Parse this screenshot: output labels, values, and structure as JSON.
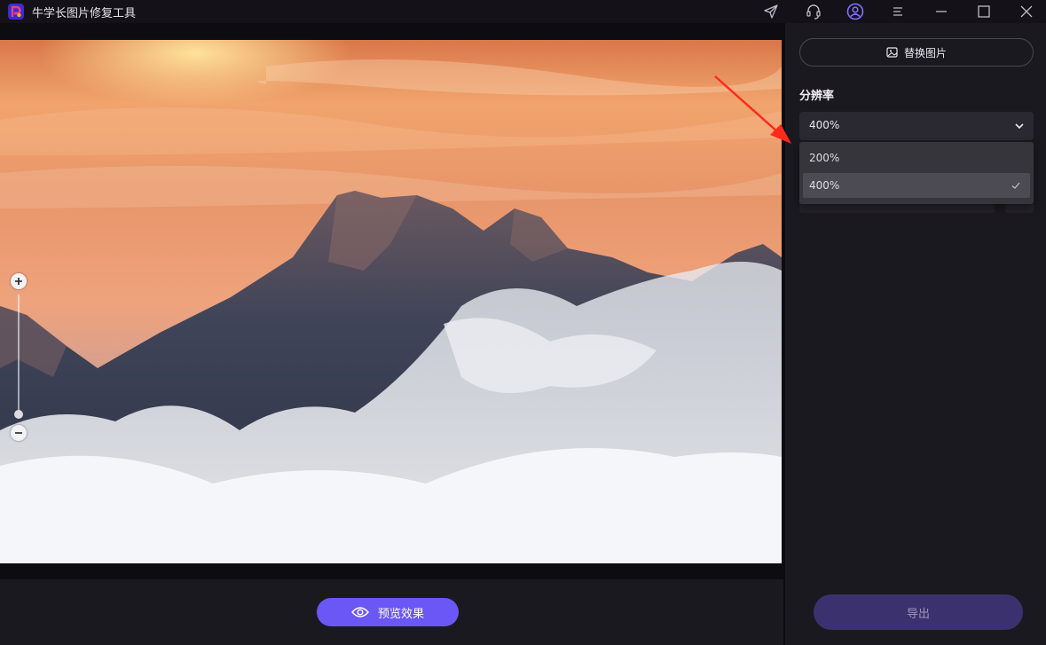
{
  "app": {
    "title": "牛学长图片修复工具"
  },
  "titlebar_icons": [
    "send-icon",
    "headset-icon",
    "user-icon",
    "menu-icon",
    "minimize-icon",
    "maximize-icon",
    "close-icon"
  ],
  "preview": {
    "label": "预览效果"
  },
  "panel": {
    "replace_label": "替换图片",
    "resolution_label": "分辨率",
    "resolution_value": "400%",
    "options": [
      {
        "label": "200%",
        "selected": false
      },
      {
        "label": "400%",
        "selected": true
      }
    ],
    "export_label": "导出"
  },
  "colors": {
    "accent": "#6b57f5",
    "export_disabled": "#3c316f",
    "annotation_arrow": "#ff2a1a"
  }
}
